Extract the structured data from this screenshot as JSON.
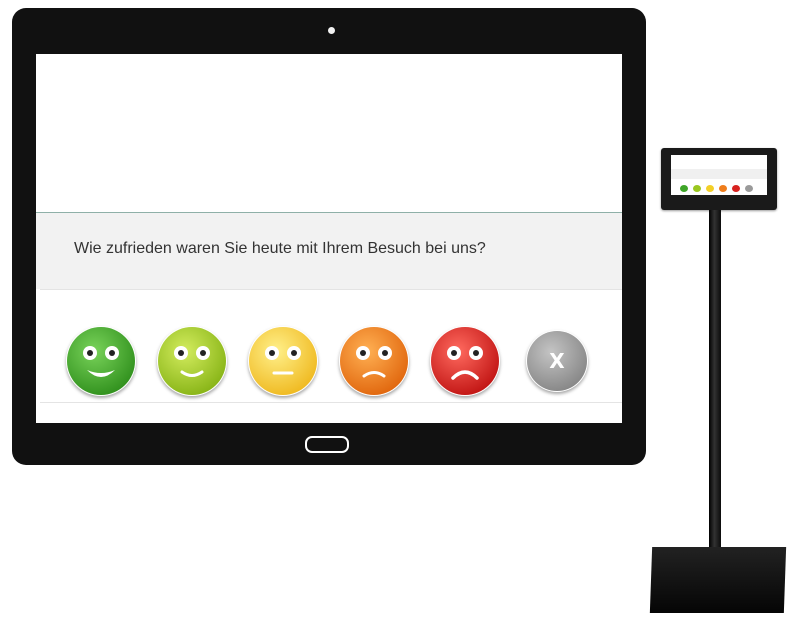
{
  "survey": {
    "question": "Wie zufrieden waren Sie heute mit Ihrem Besuch bei uns?",
    "ratings": [
      {
        "name": "very-happy-face-icon",
        "color": "#3fa528"
      },
      {
        "name": "happy-face-icon",
        "color": "#9ac71f"
      },
      {
        "name": "neutral-face-icon",
        "color": "#f3cf27"
      },
      {
        "name": "unhappy-face-icon",
        "color": "#ef7d1c"
      },
      {
        "name": "very-unhappy-face-icon",
        "color": "#d8221f"
      }
    ],
    "skip": {
      "label": "X",
      "color": "#9a9a9a"
    }
  },
  "colors": {
    "device_frame": "#111111",
    "question_panel": "#f2f2f2",
    "divider": "#8fb0a8"
  }
}
